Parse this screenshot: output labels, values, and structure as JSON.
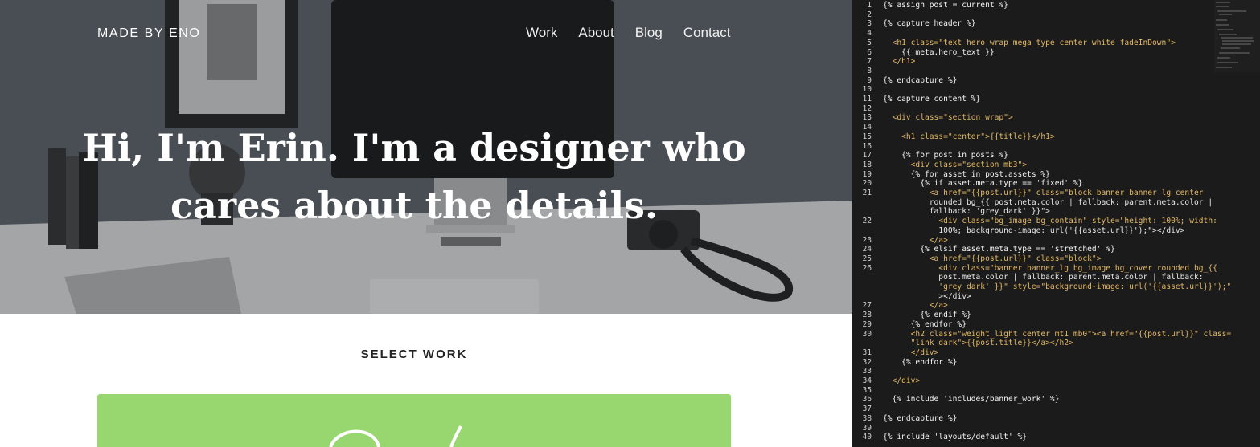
{
  "site": {
    "brand": "MADE BY ENO",
    "nav": [
      "Work",
      "About",
      "Blog",
      "Contact"
    ],
    "hero_line1": "Hi, I'm Erin. I'm a designer who",
    "hero_line2": "cares about the details.",
    "section_title": "SELECT WORK",
    "colors": {
      "hero_bg": "#4a5055",
      "banner": "#98d770",
      "code_bg": "#1b1b1b"
    }
  },
  "editor": {
    "lines": [
      {
        "n": "1",
        "t": "{% assign post = current %}"
      },
      {
        "n": "2",
        "t": ""
      },
      {
        "n": "3",
        "t": "{% capture header %}"
      },
      {
        "n": "4",
        "t": ""
      },
      {
        "n": "5",
        "t": "  <h1 class=\"text_hero wrap mega_type center white fadeInDown\">"
      },
      {
        "n": "6",
        "t": "    {{ meta.hero_text }}"
      },
      {
        "n": "7",
        "t": "  </h1>"
      },
      {
        "n": "8",
        "t": ""
      },
      {
        "n": "9",
        "t": "{% endcapture %}"
      },
      {
        "n": "10",
        "t": ""
      },
      {
        "n": "11",
        "t": "{% capture content %}"
      },
      {
        "n": "12",
        "t": ""
      },
      {
        "n": "13",
        "t": "  <div class=\"section wrap\">"
      },
      {
        "n": "14",
        "t": ""
      },
      {
        "n": "15",
        "t": "    <h1 class=\"center\">{{title}}</h1>"
      },
      {
        "n": "16",
        "t": ""
      },
      {
        "n": "17",
        "t": "    {% for post in posts %}"
      },
      {
        "n": "18",
        "t": "      <div class=\"section mb3\">"
      },
      {
        "n": "19",
        "t": "      {% for asset in post.assets %}"
      },
      {
        "n": "20",
        "t": "        {% if asset.meta.type == 'fixed' %}"
      },
      {
        "n": "21",
        "t": "          <a href=\"{{post.url}}\" class=\"block banner banner_lg center"
      },
      {
        "n": "",
        "t": "          rounded bg_{{ post.meta.color | fallback: parent.meta.color |"
      },
      {
        "n": "",
        "t": "          fallback: 'grey_dark' }}\">"
      },
      {
        "n": "22",
        "t": "            <div class=\"bg_image bg_contain\" style=\"height: 100%; width:"
      },
      {
        "n": "",
        "t": "            100%; background-image: url('{{asset.url}}');\"></div>"
      },
      {
        "n": "23",
        "t": "          </a>"
      },
      {
        "n": "24",
        "t": "        {% elsif asset.meta.type == 'stretched' %}"
      },
      {
        "n": "25",
        "t": "          <a href=\"{{post.url}}\" class=\"block\">"
      },
      {
        "n": "26",
        "t": "            <div class=\"banner banner_lg bg_image bg_cover rounded bg_{{"
      },
      {
        "n": "",
        "t": "            post.meta.color | fallback: parent.meta.color | fallback:"
      },
      {
        "n": "",
        "t": "            'grey_dark' }}\" style=\"background-image: url('{{asset.url}}');\""
      },
      {
        "n": "",
        "t": "            ></div>"
      },
      {
        "n": "27",
        "t": "          </a>"
      },
      {
        "n": "28",
        "t": "        {% endif %}"
      },
      {
        "n": "29",
        "t": "      {% endfor %}"
      },
      {
        "n": "30",
        "t": "      <h2 class=\"weight_light center mt1 mb0\"><a href=\"{{post.url}}\" class="
      },
      {
        "n": "",
        "t": "      \"link_dark\">{{post.title}}</a></h2>"
      },
      {
        "n": "31",
        "t": "      </div>"
      },
      {
        "n": "32",
        "t": "    {% endfor %}"
      },
      {
        "n": "33",
        "t": ""
      },
      {
        "n": "34",
        "t": "  </div>"
      },
      {
        "n": "35",
        "t": ""
      },
      {
        "n": "36",
        "t": "  {% include 'includes/banner_work' %}"
      },
      {
        "n": "37",
        "t": ""
      },
      {
        "n": "38",
        "t": "{% endcapture %}"
      },
      {
        "n": "39",
        "t": ""
      },
      {
        "n": "40",
        "t": "{% include 'layouts/default' %}"
      }
    ]
  }
}
